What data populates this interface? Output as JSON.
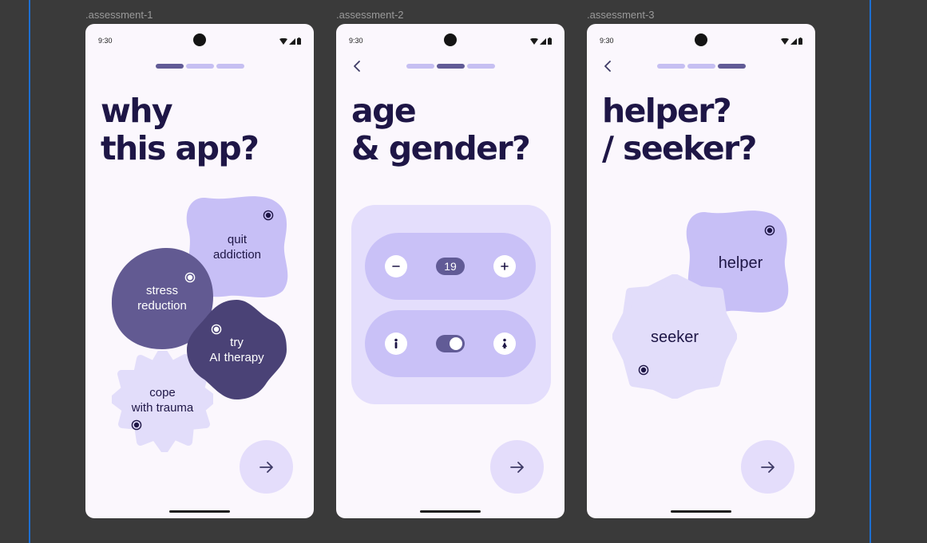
{
  "status_bar": {
    "time": "9:30"
  },
  "frames": [
    {
      "label": ".assessment-1",
      "title_lines": [
        "why",
        "this app?"
      ],
      "progress_active": 1
    },
    {
      "label": ".assessment-2",
      "title_lines": [
        "age",
        "& gender?"
      ],
      "progress_active": 2
    },
    {
      "label": ".assessment-3",
      "title_lines": [
        "helper?",
        "/ seeker?"
      ],
      "progress_active": 3
    }
  ],
  "assessment1": {
    "options": [
      {
        "lines": [
          "quit",
          "addiction"
        ]
      },
      {
        "lines": [
          "stress",
          "reduction"
        ]
      },
      {
        "lines": [
          "try",
          "AI therapy"
        ]
      },
      {
        "lines": [
          "cope",
          "with trauma"
        ]
      }
    ]
  },
  "assessment2": {
    "age": {
      "value": "19",
      "decrement_icon": "minus-icon",
      "increment_icon": "plus-icon"
    },
    "gender": {
      "left_icon": "person-icon",
      "right_icon": "person-icon",
      "toggle_on": true
    }
  },
  "assessment3": {
    "options": [
      {
        "label": "helper"
      },
      {
        "label": "seeker"
      }
    ]
  },
  "icons": {
    "next": "arrow-right-icon",
    "back": "chevron-left-icon",
    "selected": "radio-selected-icon"
  },
  "colors": {
    "background": "#3a3a3a",
    "screen": "#fbf7fd",
    "title": "#1e1646",
    "accent_dark": "#615b96",
    "accent_light": "#c6bff2",
    "blob_lavender": "#c7bff6",
    "blob_purple": "#625a92",
    "blob_indigo": "#4a4276",
    "blob_pale": "#e2ddfa",
    "card": "#e4defc",
    "guide": "#1d6fd1"
  }
}
